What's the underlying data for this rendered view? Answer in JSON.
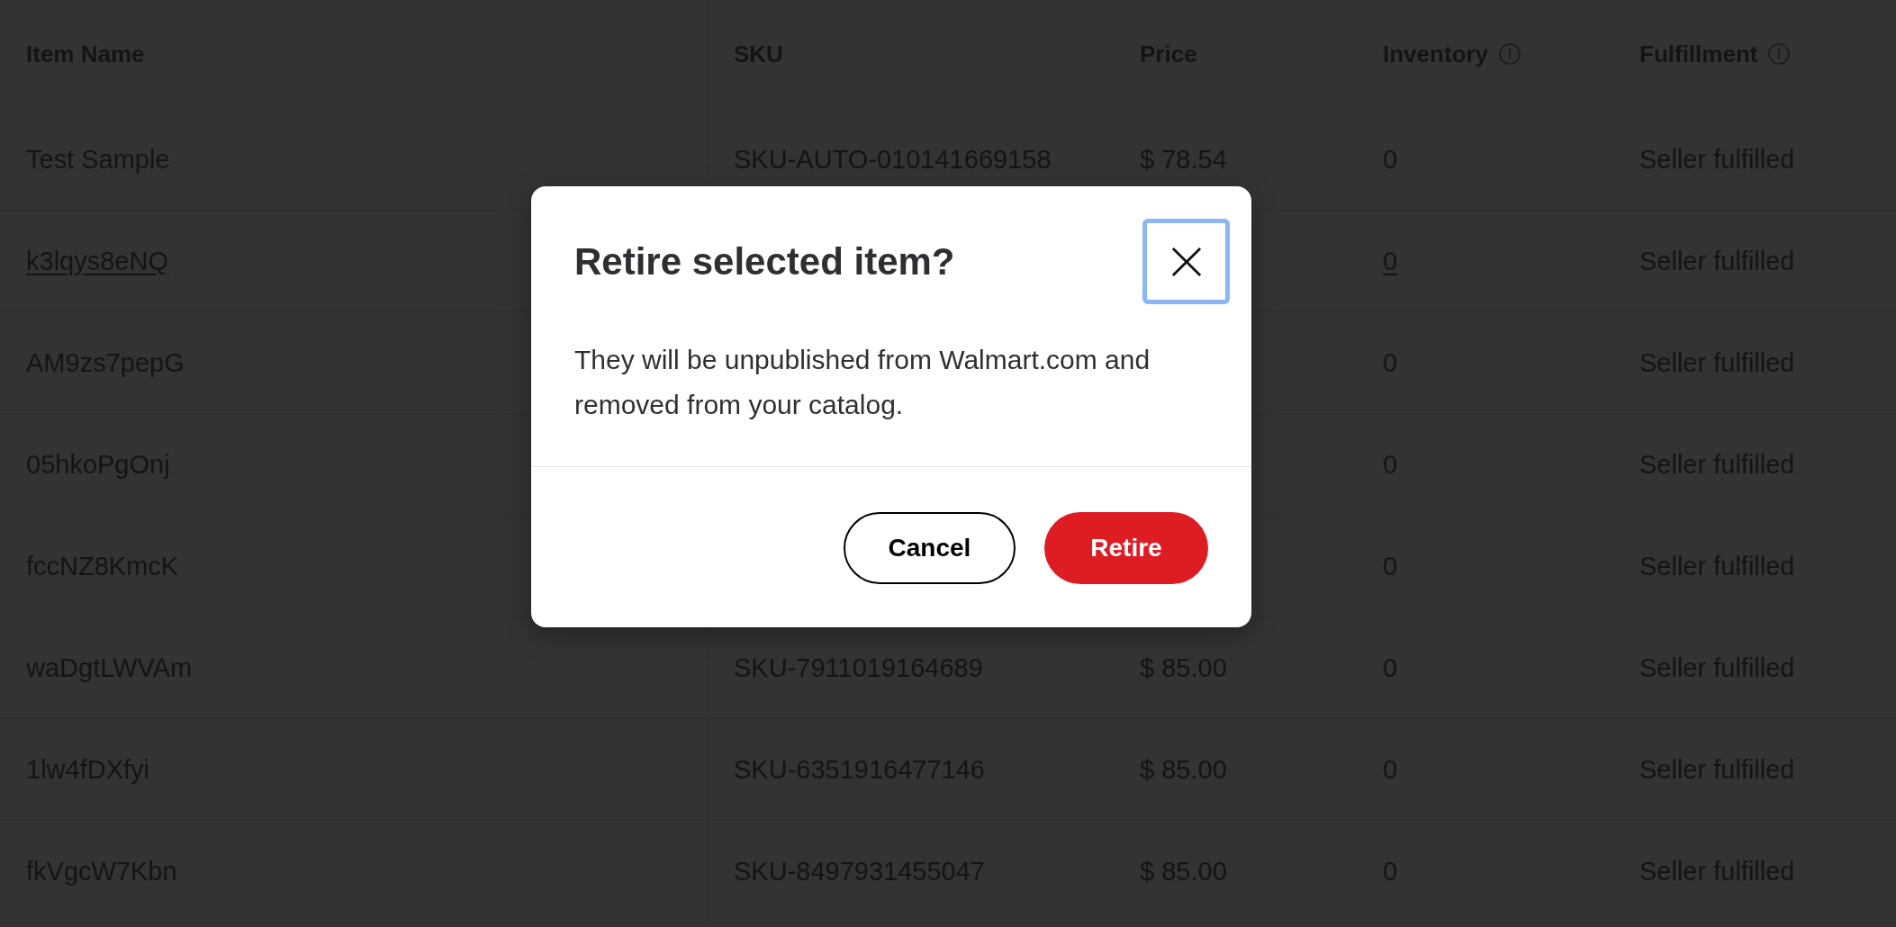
{
  "table": {
    "columns": [
      {
        "label": "Item Name",
        "info": false
      },
      {
        "label": "SKU",
        "info": false
      },
      {
        "label": "Price",
        "info": false
      },
      {
        "label": "Inventory",
        "info": true
      },
      {
        "label": "Fulfillment",
        "info": true
      }
    ],
    "rows": [
      {
        "item_name": "Test Sample",
        "item_name_link": false,
        "sku": "SKU-AUTO-010141669158",
        "price": "$ 78.54",
        "inventory": "0",
        "inventory_link": false,
        "fulfillment": "Seller fulfilled"
      },
      {
        "item_name": "k3lqys8eNQ",
        "item_name_link": true,
        "inventory": "0",
        "inventory_link": true,
        "fulfillment": "Seller fulfilled"
      },
      {
        "item_name": "AM9zs7pepG",
        "item_name_link": false,
        "inventory": "0",
        "inventory_link": false,
        "fulfillment": "Seller fulfilled"
      },
      {
        "item_name": "05hkoPgOnj",
        "item_name_link": false,
        "inventory": "0",
        "inventory_link": false,
        "fulfillment": "Seller fulfilled"
      },
      {
        "item_name": "fccNZ8KmcK",
        "item_name_link": false,
        "inventory": "0",
        "inventory_link": false,
        "fulfillment": "Seller fulfilled"
      },
      {
        "item_name": "waDgtLWVAm",
        "item_name_link": false,
        "sku": "SKU-7911019164689",
        "price": "$ 85.00",
        "inventory": "0",
        "inventory_link": false,
        "fulfillment": "Seller fulfilled"
      },
      {
        "item_name": "1lw4fDXfyi",
        "item_name_link": false,
        "sku": "SKU-6351916477146",
        "price": "$ 85.00",
        "inventory": "0",
        "inventory_link": false,
        "fulfillment": "Seller fulfilled"
      },
      {
        "item_name": "fkVgcW7Kbn",
        "item_name_link": false,
        "sku": "SKU-8497931455047",
        "price": "$ 85.00",
        "inventory": "0",
        "inventory_link": false,
        "fulfillment": "Seller fulfilled"
      }
    ]
  },
  "dialog": {
    "title": "Retire selected item?",
    "close_focused": true,
    "message": "They will be unpublished from Walmart.com and removed from your catalog.",
    "buttons": [
      {
        "label": "Cancel",
        "kind": "secondary"
      },
      {
        "label": "Retire",
        "kind": "primary"
      }
    ]
  }
}
